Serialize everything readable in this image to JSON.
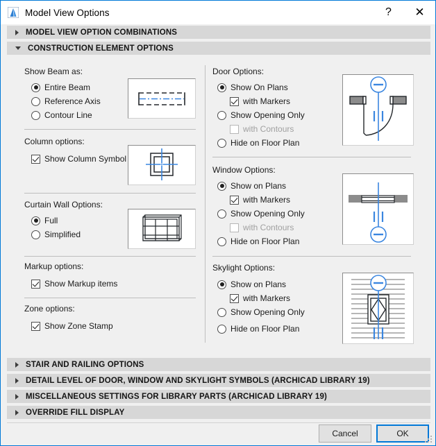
{
  "window": {
    "title": "Model View Options",
    "app_icon": "archicad-icon",
    "help_label": "?",
    "close_label": "✕"
  },
  "sections": [
    {
      "label": "MODEL VIEW OPTION COMBINATIONS",
      "expanded": false
    },
    {
      "label": "CONSTRUCTION ELEMENT OPTIONS",
      "expanded": true
    },
    {
      "label": "STAIR AND RAILING OPTIONS",
      "expanded": false
    },
    {
      "label": "DETAIL LEVEL OF DOOR, WINDOW AND SKYLIGHT SYMBOLS (ARCHICAD LIBRARY 19)",
      "expanded": false
    },
    {
      "label": "MISCELLANEOUS SETTINGS FOR LIBRARY PARTS (ARCHICAD LIBRARY 19)",
      "expanded": false
    },
    {
      "label": "OVERRIDE FILL DISPLAY",
      "expanded": false
    }
  ],
  "left_column": {
    "beam": {
      "title": "Show Beam as:",
      "options": [
        {
          "label": "Entire Beam",
          "selected": true
        },
        {
          "label": "Reference Axis",
          "selected": false
        },
        {
          "label": "Contour Line",
          "selected": false
        }
      ],
      "preview": "beam-entire-preview"
    },
    "column": {
      "title": "Column options:",
      "checkbox": {
        "label": "Show Column Symbol",
        "checked": true
      },
      "preview": "column-symbol-preview"
    },
    "curtain_wall": {
      "title": "Curtain Wall Options:",
      "options": [
        {
          "label": "Full",
          "selected": true
        },
        {
          "label": "Simplified",
          "selected": false
        }
      ],
      "preview": "curtain-wall-preview"
    },
    "markup": {
      "title": "Markup options:",
      "checkbox": {
        "label": "Show Markup items",
        "checked": true
      }
    },
    "zone": {
      "title": "Zone options:",
      "checkbox": {
        "label": "Show Zone Stamp",
        "checked": true
      }
    }
  },
  "right_column": {
    "door": {
      "title": "Door Options:",
      "options": [
        {
          "label": "Show On Plans",
          "selected": true
        },
        {
          "label": "Show Opening Only",
          "selected": false
        },
        {
          "label": "Hide on Floor Plan",
          "selected": false
        }
      ],
      "sub_with_markers": {
        "label": "with Markers",
        "checked": true,
        "disabled": false
      },
      "sub_with_contours": {
        "label": "with Contours",
        "checked": false,
        "disabled": true
      },
      "preview": "door-plan-preview"
    },
    "window": {
      "title": "Window Options:",
      "options": [
        {
          "label": "Show on Plans",
          "selected": true
        },
        {
          "label": "Show Opening Only",
          "selected": false
        },
        {
          "label": "Hide on Floor Plan",
          "selected": false
        }
      ],
      "sub_with_markers": {
        "label": "with Markers",
        "checked": true,
        "disabled": false
      },
      "sub_with_contours": {
        "label": "with Contours",
        "checked": false,
        "disabled": true
      },
      "preview": "window-plan-preview"
    },
    "skylight": {
      "title": "Skylight Options:",
      "options": [
        {
          "label": "Show on Plans",
          "selected": true
        },
        {
          "label": "Show Opening Only",
          "selected": false
        },
        {
          "label": "Hide on Floor Plan",
          "selected": false
        }
      ],
      "sub_with_markers": {
        "label": "with Markers",
        "checked": true,
        "disabled": false
      },
      "preview": "skylight-plan-preview"
    }
  },
  "footer": {
    "cancel_label": "Cancel",
    "ok_label": "OK"
  },
  "colors": {
    "accent": "#0078d7",
    "section_bar": "#d7d7d7",
    "dialog_bg": "#f0f0f0",
    "preview_blue": "#3a86e0"
  }
}
